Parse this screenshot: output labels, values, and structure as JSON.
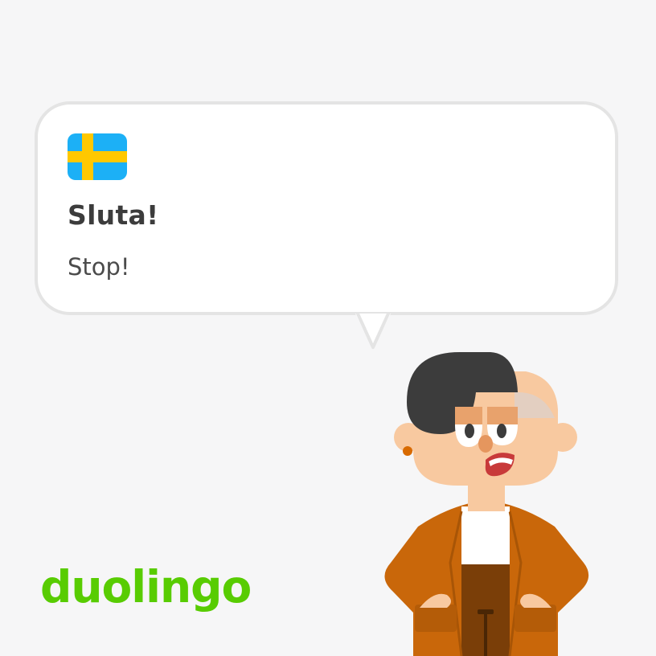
{
  "card": {
    "flag_icon": "sweden-flag-icon",
    "phrase": "Sluta!",
    "translation": "Stop!"
  },
  "brand": {
    "logo_text": "duolingo",
    "logo_color": "#58cc02"
  },
  "character": {
    "icon": "lily-character-illustration"
  },
  "colors": {
    "background": "#f6f6f7",
    "bubble_border": "#e4e4e4",
    "flag_blue": "#1cb0f6",
    "flag_yellow": "#ffc800",
    "jacket": "#c9670a",
    "hair": "#3c3c3c"
  }
}
